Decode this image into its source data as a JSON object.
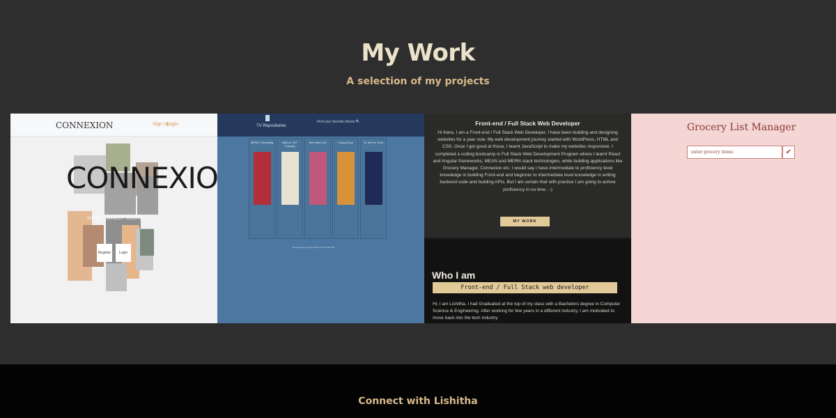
{
  "section": {
    "title": "My Work",
    "subtitle": "A selection of my projects"
  },
  "projects": [
    {
      "name": "connexion",
      "brand": "CONNEXION",
      "nav_signup": "Sign Up",
      "nav_login": "Login",
      "hero_brand": "CONNEXION",
      "tags": [
        "SHARE",
        "CONNECT",
        "CREATE"
      ],
      "register_label": "Register",
      "login_label": "Login"
    },
    {
      "name": "tv-repository",
      "title": "TV Repositories",
      "search_hint": "Find your favorite shows",
      "shows": [
        "IMPACT Wrestling",
        "NBA on TNT Tuesday",
        "Teen Mom OG",
        "Young Rock",
        "To Tell the Truth"
      ],
      "footer_note": "Developed by me with data from TVmaze API"
    },
    {
      "name": "portfolio",
      "hero_title": "Front-end / Full Stack Web Developer",
      "hero_text": "Hi there, I am a Front-end / Full Stack Web Developer. I have been building and designing websites for a year now. My web development journey started with WordPress, HTML and CSS. Once I got good at those, I learnt JavaScript to make my websites responsive. I completed a coding bootcamp in Full Stack Web Development Program where I learnt React and Angular frameworks, MEAN and MERN stack technologies, while building applications like Grocery Manager, Connexion etc. I would say I have intermediate to proficiency level knowledge in building Front-end and beginner to intermediate level knowledge in writing backend code and building APIs. But I am certain that with practice I am going to achive proficiency in no time. :-)",
      "hero_button": "MY WORK",
      "about_title": "Who I am",
      "about_role": "Front-end / Full Stack web developer",
      "about_text": "Hi, I am Lishitha. I had Graduated at the top of my class with a Bachelors degree in Computer Science & Engineering. After working for few years in a different industry, I am motivated to move back into the tech industry."
    },
    {
      "name": "grocery",
      "title": "Grocery List Manager",
      "input_placeholder": "enter grocery items",
      "check_glyph": "✔"
    }
  ],
  "poster_colors": [
    "#b22e38",
    "#e8e2d2",
    "#c0587a",
    "#d8923a",
    "#1f2a56"
  ],
  "footer": {
    "text": "Connect with Lishitha"
  }
}
